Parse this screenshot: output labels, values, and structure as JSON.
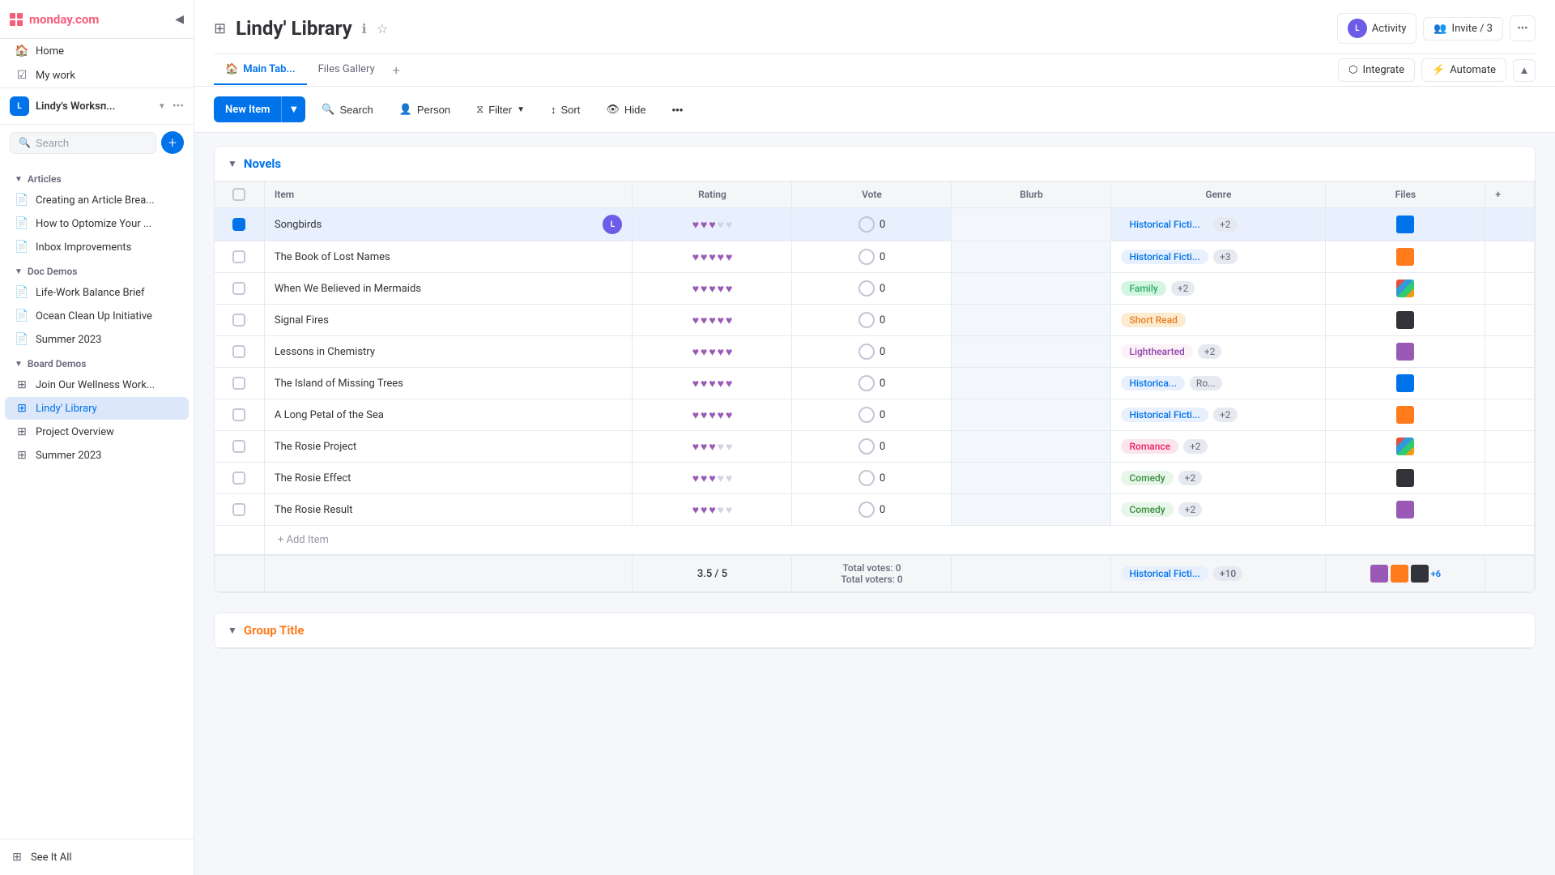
{
  "app": {
    "logo": "monday.com"
  },
  "topnav": {
    "title": "monday.com",
    "icons": [
      "bell",
      "inbox",
      "people",
      "gift",
      "search",
      "help"
    ]
  },
  "sidebar": {
    "collapse_label": "◀",
    "home_label": "Home",
    "my_work_label": "My work",
    "workspace": {
      "name": "Lindy's Worksп...",
      "icon": "L"
    },
    "search_placeholder": "Search",
    "add_label": "+",
    "sections": [
      {
        "name": "articles",
        "label": "Articles",
        "items": [
          {
            "label": "Creating an Article Brea...",
            "icon": "📄"
          },
          {
            "label": "How to Optomize Your ...",
            "icon": "📄"
          },
          {
            "label": "Inbox Improvements",
            "icon": "📄"
          }
        ]
      },
      {
        "name": "doc-demos",
        "label": "Doc Demos",
        "items": [
          {
            "label": "Life-Work Balance Brief",
            "icon": "📄"
          },
          {
            "label": "Ocean Clean Up Initiative",
            "icon": "📄"
          },
          {
            "label": "Summer 2023",
            "icon": "📄"
          }
        ]
      },
      {
        "name": "board-demos",
        "label": "Board Demos",
        "items": [
          {
            "label": "Join Our Wellness Work...",
            "icon": "⊞"
          },
          {
            "label": "Lindy' Library",
            "icon": "⊞",
            "active": true
          },
          {
            "label": "Project Overview",
            "icon": "⊞"
          },
          {
            "label": "Summer 2023",
            "icon": "⊞"
          }
        ]
      }
    ],
    "footer": {
      "see_it_all": "See It All",
      "icon": "⊞"
    }
  },
  "board": {
    "title": "Lindy' Library",
    "tabs": [
      {
        "label": "Main Tab...",
        "icon": "🏠",
        "active": true
      },
      {
        "label": "Files Gallery",
        "active": false
      }
    ],
    "toolbar": {
      "new_item": "New Item",
      "search": "Search",
      "person": "Person",
      "filter": "Filter",
      "sort": "Sort",
      "hide": "Hide"
    },
    "activity_label": "Activity",
    "invite_label": "Invite / 3",
    "integrate_label": "Integrate",
    "automate_label": "Automate"
  },
  "novels_group": {
    "title": "Novels",
    "color": "#0073ea",
    "columns": [
      "Item",
      "Rating",
      "Vote",
      "Blurb",
      "Genre",
      "Files"
    ],
    "rows": [
      {
        "name": "Songbirds",
        "rating": 3,
        "vote": 0,
        "genre": "Historical Ficti...",
        "genre_type": "hist",
        "extra": "+2",
        "has_file": true,
        "has_person": true
      },
      {
        "name": "The Book of Lost Names",
        "rating": 5,
        "vote": 0,
        "genre": "Historical Ficti...",
        "genre_type": "hist",
        "extra": "+3",
        "has_file": true
      },
      {
        "name": "When We Believed in Mermaids",
        "rating": 5,
        "vote": 0,
        "genre": "Family",
        "genre_type": "family",
        "extra": "+2",
        "has_file": true
      },
      {
        "name": "Signal Fires",
        "rating": 5,
        "vote": 0,
        "genre": "Short Read",
        "genre_type": "short",
        "extra": "",
        "has_file": true
      },
      {
        "name": "Lessons in Chemistry",
        "rating": 5,
        "vote": 0,
        "genre": "Lighthearted",
        "genre_type": "light",
        "extra": "+2",
        "has_file": true
      },
      {
        "name": "The Island of Missing Trees",
        "rating": 5,
        "vote": 0,
        "genre": "Historica...",
        "genre_type": "hist",
        "extra": "Ro...",
        "has_file": true
      },
      {
        "name": "A Long Petal of the Sea",
        "rating": 5,
        "vote": 0,
        "genre": "Historical Ficti...",
        "genre_type": "hist",
        "extra": "+2",
        "has_file": true
      },
      {
        "name": "The Rosie Project",
        "rating": 3,
        "vote": 0,
        "genre": "Romance",
        "genre_type": "romance",
        "extra": "+2",
        "has_file": true
      },
      {
        "name": "The Rosie Effect",
        "rating": 3,
        "vote": 0,
        "genre": "Comedy",
        "genre_type": "comedy",
        "extra": "+2",
        "has_file": true
      },
      {
        "name": "The Rosie Result",
        "rating": 3,
        "vote": 0,
        "genre": "Comedy",
        "genre_type": "comedy",
        "extra": "+2",
        "has_file": true
      }
    ],
    "add_item": "+ Add Item",
    "footer": {
      "rating": "3.5 / 5",
      "vote_total": "Total votes: 0",
      "vote_voters": "Total voters: 0",
      "genre": "Historical Ficti...",
      "genre_more": "+10",
      "files_more": "+6"
    }
  },
  "group2": {
    "title": "Group Title",
    "color": "#ff7b1c"
  }
}
